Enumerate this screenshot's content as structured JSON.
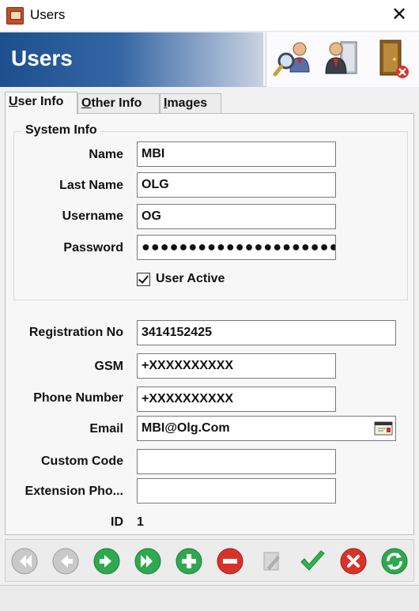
{
  "window": {
    "title": "Users",
    "icon": "app-icon",
    "close_label": "✕"
  },
  "header": {
    "title": "Users",
    "tools": [
      {
        "name": "search-user-icon"
      },
      {
        "name": "user-permissions-icon"
      },
      {
        "name": "exit-door-icon"
      }
    ]
  },
  "tabs": [
    {
      "label_ul": "U",
      "label_rest": "ser Info",
      "active": true
    },
    {
      "label_ul": "O",
      "label_rest": "ther Info",
      "active": false
    },
    {
      "label_ul": "I",
      "label_rest": "mages",
      "active": false
    }
  ],
  "system_info": {
    "legend": "System Info",
    "name_label": "Name",
    "name_value": "MBI",
    "lastname_label": "Last Name",
    "lastname_value": "OLG",
    "username_label": "Username",
    "username_value": "OG",
    "password_label": "Password",
    "password_value": "●●●●●●●●●●●●●●●●●●●●●●",
    "active_label": "User Active",
    "active_checked": true
  },
  "details": {
    "regno_label": "Registration No",
    "regno_value": "3414152425",
    "gsm_label": "GSM",
    "gsm_value": "+XXXXXXXXXX",
    "phone_label": "Phone Number",
    "phone_value": "+XXXXXXXXXX",
    "email_label": "Email",
    "email_value": "MBI@Olg.Com",
    "custom_label": "Custom Code",
    "custom_value": "",
    "ext_label": "Extension Pho...",
    "ext_value": "",
    "id_label": "ID",
    "id_value": "1"
  },
  "nav": [
    {
      "name": "first-record-icon",
      "enabled": false
    },
    {
      "name": "prev-record-icon",
      "enabled": false
    },
    {
      "name": "next-record-icon",
      "enabled": true
    },
    {
      "name": "last-record-icon",
      "enabled": true
    },
    {
      "name": "add-record-icon",
      "enabled": true
    },
    {
      "name": "delete-record-icon",
      "enabled": true
    },
    {
      "name": "edit-record-icon",
      "enabled": false
    },
    {
      "name": "save-check-icon",
      "enabled": true
    },
    {
      "name": "cancel-x-icon",
      "enabled": true
    },
    {
      "name": "refresh-icon",
      "enabled": true
    }
  ],
  "colors": {
    "banner_blue": "#1d4f8f",
    "nav_green": "#2fa84f",
    "nav_red": "#d8332a",
    "nav_gray": "#c9c9c9"
  }
}
